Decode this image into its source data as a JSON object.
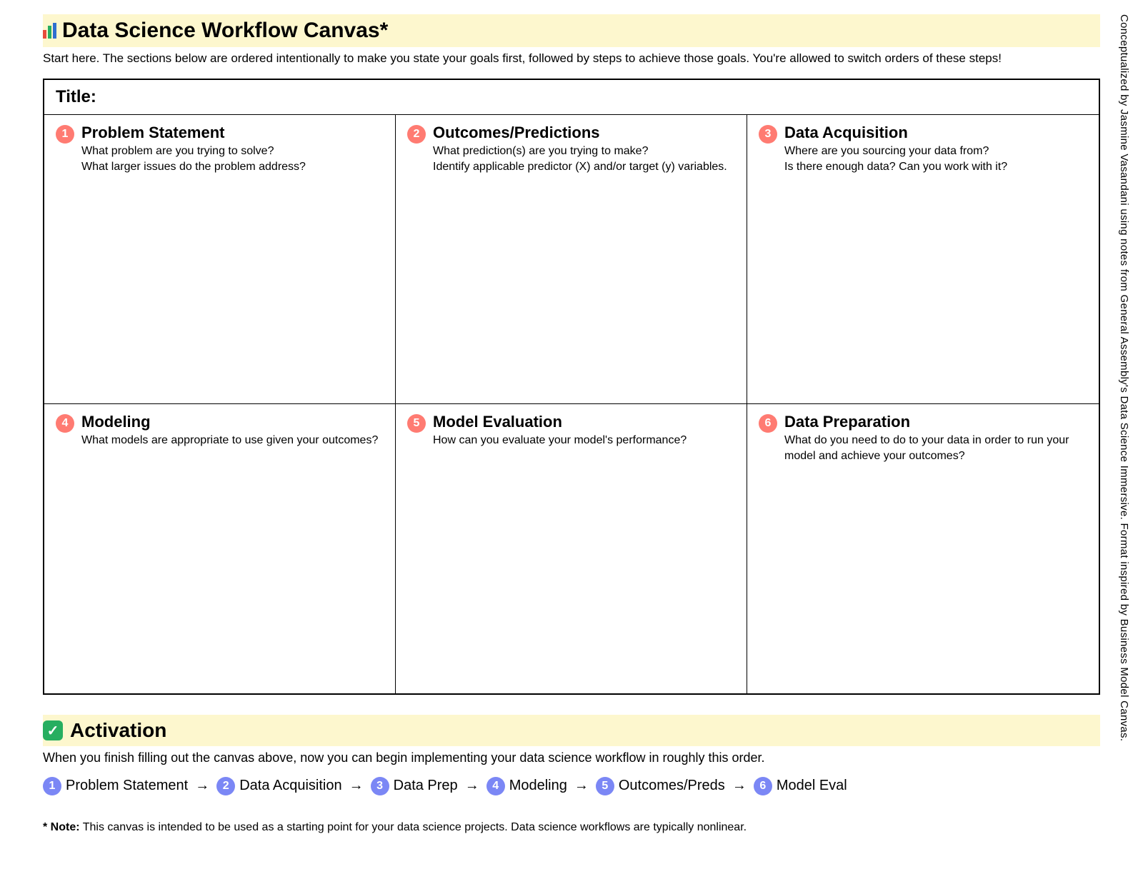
{
  "header": {
    "title": "Data Science Workflow Canvas*",
    "intro": "Start here. The sections below are ordered intentionally to make you state your goals first, followed by steps to achieve those goals. You're allowed to switch orders of these steps!"
  },
  "canvas": {
    "title_label": "Title:",
    "cells": [
      {
        "num": "1",
        "title": "Problem Statement",
        "desc": "What problem are you trying to solve?\nWhat larger issues do the problem address?"
      },
      {
        "num": "2",
        "title": "Outcomes/Predictions",
        "desc": "What prediction(s) are you trying to make?\nIdentify applicable predictor (X) and/or target (y) variables."
      },
      {
        "num": "3",
        "title": "Data Acquisition",
        "desc": "Where are you sourcing your data from?\nIs there enough data? Can you work with it?"
      },
      {
        "num": "4",
        "title": "Modeling",
        "desc": "What models are appropriate to use given your outcomes?"
      },
      {
        "num": "5",
        "title": "Model Evaluation",
        "desc": "How can you evaluate your model's performance?"
      },
      {
        "num": "6",
        "title": "Data Preparation",
        "desc": "What do you need to do to your data in order to run your model and achieve your outcomes?"
      }
    ]
  },
  "activation": {
    "title": "Activation",
    "desc": "When you finish filling out the canvas above, now you can begin implementing your data science workflow in roughly this order.",
    "flow": [
      {
        "num": "1",
        "label": "Problem Statement"
      },
      {
        "num": "2",
        "label": "Data Acquisition"
      },
      {
        "num": "3",
        "label": "Data Prep"
      },
      {
        "num": "4",
        "label": "Modeling"
      },
      {
        "num": "5",
        "label": "Outcomes/Preds"
      },
      {
        "num": "6",
        "label": "Model Eval"
      }
    ],
    "arrow": "→"
  },
  "footnote": {
    "prefix": "* Note:",
    "text": " This canvas is intended to be used as a starting point for your data science projects. Data science workflows are typically nonlinear."
  },
  "credit": "Conceptualized by Jasmine Vasandani using notes from General Assembly's Data Science Immersive. Format inspired by Business Model Canvas."
}
